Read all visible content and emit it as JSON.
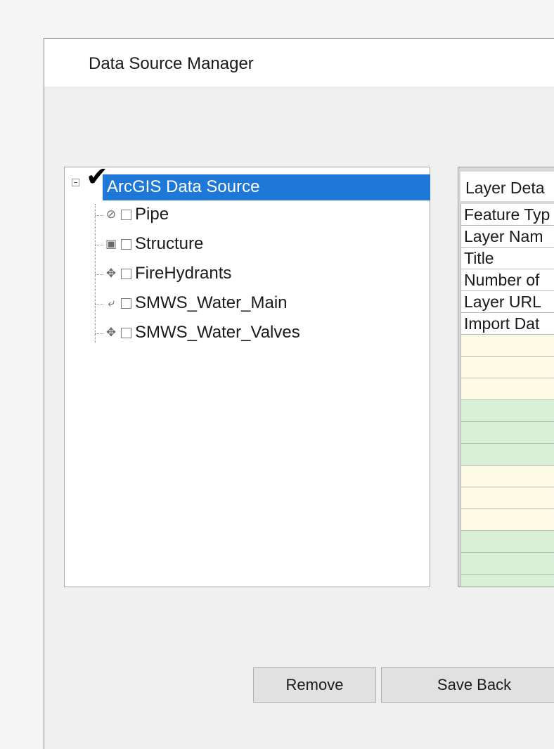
{
  "window": {
    "title": "Data Source Manager"
  },
  "tree": {
    "root": {
      "label": "ArcGIS Data Source",
      "checked": true
    },
    "items": [
      {
        "label": "Pipe",
        "icon": "line-feature-icon"
      },
      {
        "label": "Structure",
        "icon": "structure-feature-icon"
      },
      {
        "label": "FireHydrants",
        "icon": "point-feature-icon"
      },
      {
        "label": "SMWS_Water_Main",
        "icon": "line-feature-icon"
      },
      {
        "label": "SMWS_Water_Valves",
        "icon": "point-feature-icon"
      }
    ]
  },
  "details": {
    "header": "Layer Deta",
    "rows": [
      "Feature Typ",
      "Layer Nam",
      "Title",
      "Number of",
      "Layer URL",
      "Import Dat"
    ]
  },
  "buttons": {
    "remove": "Remove",
    "save_back": "Save Back"
  },
  "colors": {
    "selection": "#1e78d7",
    "row_yellow": "#fdfbe6",
    "row_green": "#d6efd5"
  }
}
